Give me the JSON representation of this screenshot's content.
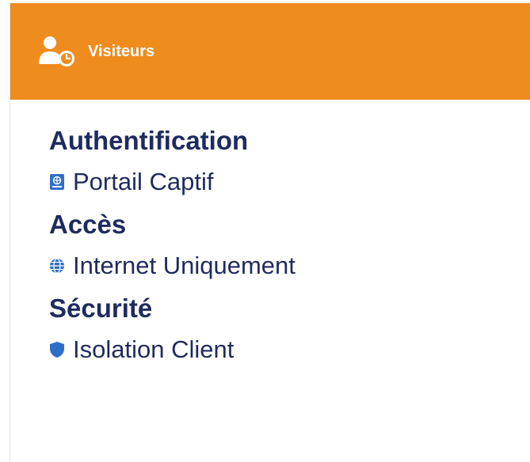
{
  "header": {
    "title": "Visiteurs",
    "icon": "visitor-clock-icon",
    "background_color": "#ef8c1e"
  },
  "sections": [
    {
      "heading": "Authentification",
      "item": {
        "label": "Portail Captif",
        "icon": "captive-portal-icon"
      }
    },
    {
      "heading": "Accès",
      "item": {
        "label": "Internet Uniquement",
        "icon": "globe-icon"
      }
    },
    {
      "heading": "Sécurité",
      "item": {
        "label": "Isolation Client",
        "icon": "shield-icon"
      }
    }
  ],
  "colors": {
    "text": "#1f2b5e",
    "accent_blue": "#2f6fc9"
  }
}
